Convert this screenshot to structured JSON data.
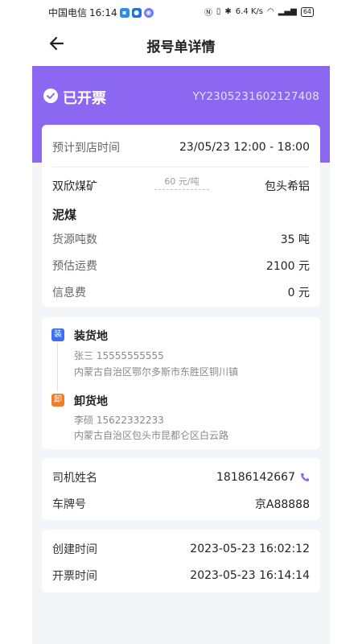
{
  "status_bar": {
    "carrier": "中国电信",
    "time": "16:14",
    "speed": "6.4 K/s",
    "battery": "64"
  },
  "header": {
    "title": "报号单详情"
  },
  "banner": {
    "status": "已开票",
    "order_no": "YY2305231602127408"
  },
  "trip": {
    "arrival_label": "预计到店时间",
    "arrival_value": "23/05/23 12:00 - 18:00",
    "from": "双欣煤矿",
    "to": "包头希铝",
    "price": "60 元/吨",
    "goods": "泥煤",
    "rows": [
      {
        "label": "货源吨数",
        "value": "35 吨"
      },
      {
        "label": "预估运费",
        "value": "2100 元"
      },
      {
        "label": "信息费",
        "value": "0 元"
      }
    ]
  },
  "addresses": {
    "load": {
      "tag": "装",
      "title": "装货地",
      "contact": "张三 15555555555",
      "address": "内蒙古自治区鄂尔多斯市东胜区铜川镇"
    },
    "unload": {
      "tag": "卸",
      "title": "卸货地",
      "contact": "李硕 15622332233",
      "address": "内蒙古自治区包头市昆都仑区白云路"
    }
  },
  "driver": {
    "name_label": "司机姓名",
    "phone": "18186142667",
    "plate_label": "车牌号",
    "plate": "京A88888"
  },
  "times": {
    "created_label": "创建时间",
    "created": "2023-05-23 16:02:12",
    "invoiced_label": "开票时间",
    "invoiced": "2023-05-23 16:14:14"
  },
  "colors": {
    "accent": "#8c68f2",
    "load_tag": "#3d6ff6",
    "unload_tag": "#f07d2e",
    "background": "#f4f5f9"
  }
}
